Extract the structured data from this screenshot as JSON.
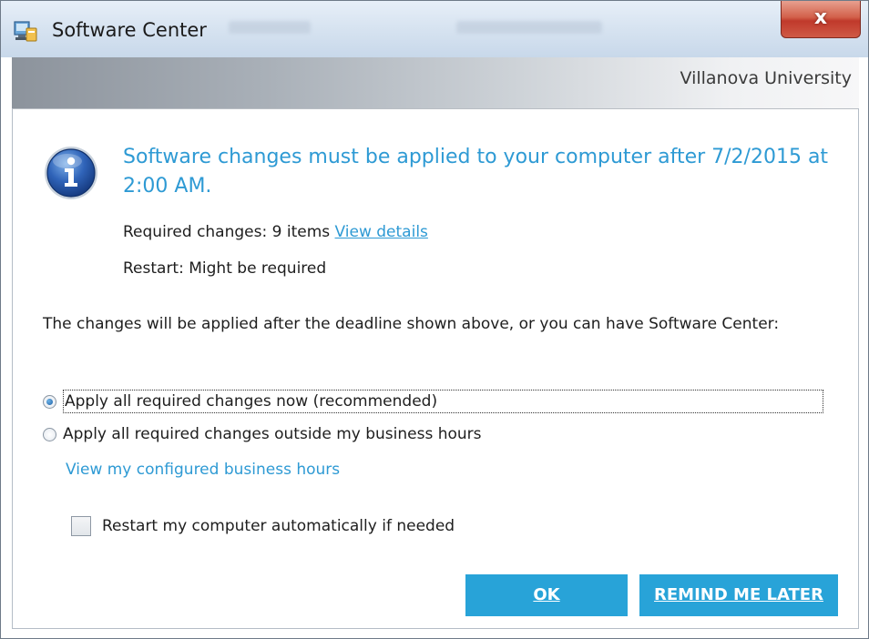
{
  "window": {
    "title": "Software Center",
    "close_label": "x"
  },
  "banner": {
    "organization": "Villanova University"
  },
  "notice": {
    "headline": "Software changes must be applied to your computer after 7/2/2015 at 2:00 AM.",
    "required_label": "Required changes:",
    "required_value": "9 items",
    "view_details_link": "View details",
    "restart_label": "Restart:",
    "restart_value": "Might be required"
  },
  "options": {
    "description": "The changes will be applied after the deadline shown above, or you can have Software Center:",
    "radios": [
      {
        "label": "Apply all required changes now (recommended)",
        "checked": true
      },
      {
        "label": "Apply all required changes outside my business hours",
        "checked": false
      }
    ],
    "business_hours_link": "View my configured business hours",
    "restart_checkbox": {
      "label": "Restart my computer automatically if needed",
      "checked": false
    }
  },
  "buttons": {
    "ok": "OK",
    "remind_later": "REMIND ME LATER"
  },
  "colors": {
    "accent_blue": "#2e9ad4",
    "button_blue": "#28a3d8",
    "close_red": "#c0392b"
  },
  "icons": {
    "app": "software-center-icon",
    "info": "info-icon"
  }
}
